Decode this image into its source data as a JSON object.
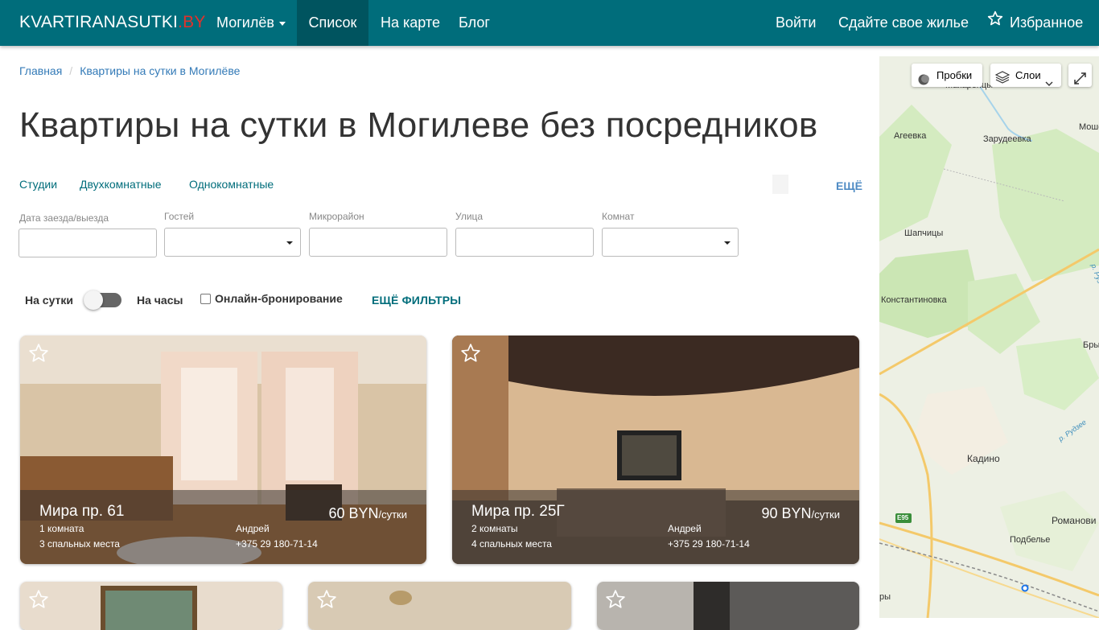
{
  "navbar": {
    "brand_main": "KVARTIRANASUTKI",
    "brand_suffix": ".BY",
    "city": "Могилёв",
    "list": "Список",
    "map": "На карте",
    "blog": "Блог",
    "login": "Войти",
    "rent_out": "Сдайте свое жилье",
    "favorites": "Избранное"
  },
  "breadcrumb": {
    "home": "Главная",
    "separator": "/",
    "current": "Квартиры на сутки в Могилёве"
  },
  "page_title": "Квартиры на сутки в Могилеве без посредников",
  "quick_links": [
    "Студии",
    "Двухкомнатные",
    "Однокомнатные"
  ],
  "more_link": "ЕЩЁ",
  "filters": {
    "dates_label": "Дата заезда/выезда",
    "guests_label": "Гостей",
    "district_label": "Микрорайон",
    "street_label": "Улица",
    "rooms_label": "Комнат",
    "dates_value": "",
    "guests_value": "",
    "district_value": "",
    "street_value": "",
    "rooms_value": ""
  },
  "toggles": {
    "per_day": "На сутки",
    "per_hour": "На часы",
    "online_booking": "Онлайн-бронирование",
    "more_filters": "ЕЩЁ ФИЛЬТРЫ"
  },
  "listings": [
    {
      "street": "Мира пр. 61",
      "rooms": "1 комната",
      "beds": "3 спальных места",
      "owner": "Андрей",
      "phone": "+375 29 180-71-14",
      "price": "60 BYN",
      "unit": "/сутки"
    },
    {
      "street": "Мира пр. 25Г",
      "rooms": "2 комнаты",
      "beds": "4 спальных места",
      "owner": "Андрей",
      "phone": "+375 29 180-71-14",
      "price": "90 BYN",
      "unit": "/сутки"
    }
  ],
  "map": {
    "traffic": "Пробки",
    "layers": "Слои",
    "towns": {
      "makarenki": "Макаренцы",
      "ageevka": "Агеевка",
      "mosh": "Моше",
      "zarudeevka": "Зарудеевка",
      "shapchitsy": "Шапчицы",
      "konstantinovka": "Константиновка",
      "bry": "Брыл",
      "kadino": "Кадино",
      "romanovi": "Романови",
      "podbelye": "Подбелье",
      "ry": "ры",
      "river1": "р. Руз",
      "river2": "р. Рудзее"
    },
    "road": "E95"
  },
  "colors": {
    "navbar": "#006d7b",
    "navbar_active": "#00545f",
    "brand_accent": "#e2312b",
    "link": "#337ab7"
  }
}
